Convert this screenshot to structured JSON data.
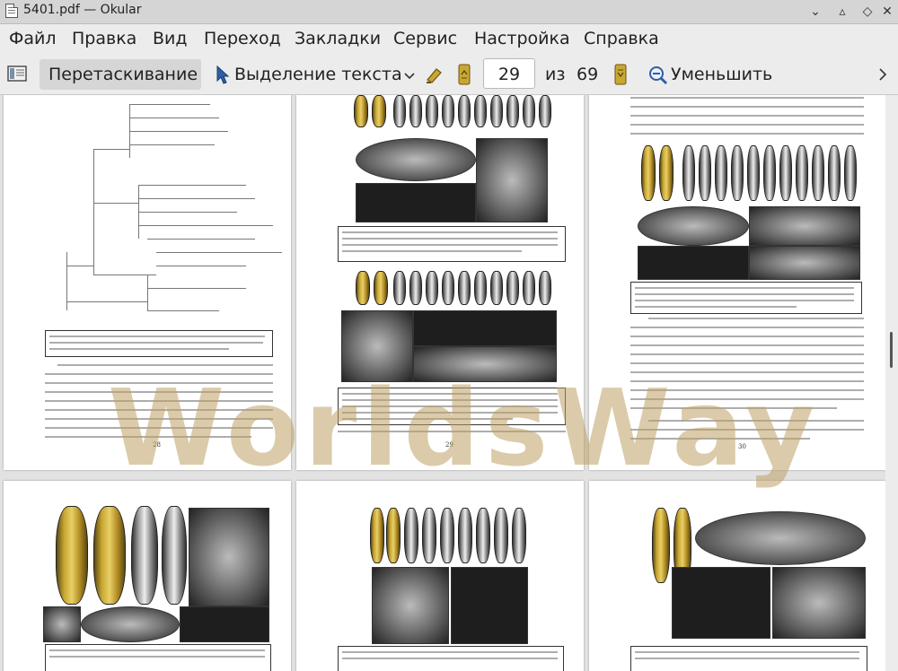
{
  "window": {
    "title": "5401.pdf  — Okular"
  },
  "menu": [
    {
      "label": "Файл"
    },
    {
      "label": "Правка"
    },
    {
      "label": "Вид"
    },
    {
      "label": "Переход"
    },
    {
      "label": "Закладки"
    },
    {
      "label": "Сервис"
    },
    {
      "label": "Настройка"
    },
    {
      "label": "Справка"
    }
  ],
  "toolbar": {
    "drag_label": "Перетаскивание",
    "select_text_label": "Выделение текста",
    "current_page": "29",
    "of_label": "из",
    "total_pages": "69",
    "zoom_out_label": "Уменьшить"
  },
  "pages": {
    "p28": {
      "number": "28"
    },
    "p29": {
      "number": "29"
    },
    "p30": {
      "number": "30"
    }
  },
  "watermark": "WorldsWay",
  "colors": {
    "accent_yellow": "#c9a733",
    "chrome": "#ececec"
  }
}
